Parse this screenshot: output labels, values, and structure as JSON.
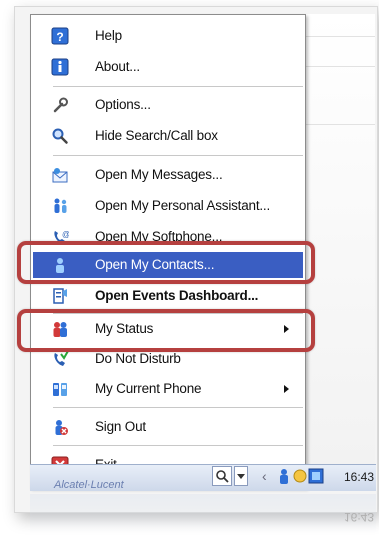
{
  "menu": {
    "items": [
      {
        "label": "Help",
        "icon": "help-icon"
      },
      {
        "label": "About...",
        "icon": "info-icon"
      },
      {
        "label": "Options...",
        "icon": "wrench-icon"
      },
      {
        "label": "Hide Search/Call box",
        "icon": "magnifier-icon"
      },
      {
        "label": "Open My Messages...",
        "icon": "messages-icon"
      },
      {
        "label": "Open My Personal Assistant...",
        "icon": "personal-assistant-icon"
      },
      {
        "label": "Open My Softphone...",
        "icon": "softphone-icon"
      },
      {
        "label": "Open My Contacts...",
        "icon": "contacts-icon",
        "selected": true
      },
      {
        "label": "Open Events Dashboard...",
        "icon": "events-dashboard-icon",
        "bold": true
      },
      {
        "label": "My Status",
        "icon": "status-icon",
        "submenu": true
      },
      {
        "label": "Do Not Disturb",
        "icon": "do-not-disturb-icon"
      },
      {
        "label": "My Current Phone",
        "icon": "phone-icon",
        "submenu": true
      },
      {
        "label": "Sign Out",
        "icon": "sign-out-icon"
      },
      {
        "label": "Exit",
        "icon": "exit-icon"
      }
    ]
  },
  "taskbar": {
    "brand": "Alcatel·Lucent",
    "clock": "16:43"
  },
  "colors": {
    "selection": "#3a5ec2",
    "highlight_frame": "#b5403f"
  }
}
